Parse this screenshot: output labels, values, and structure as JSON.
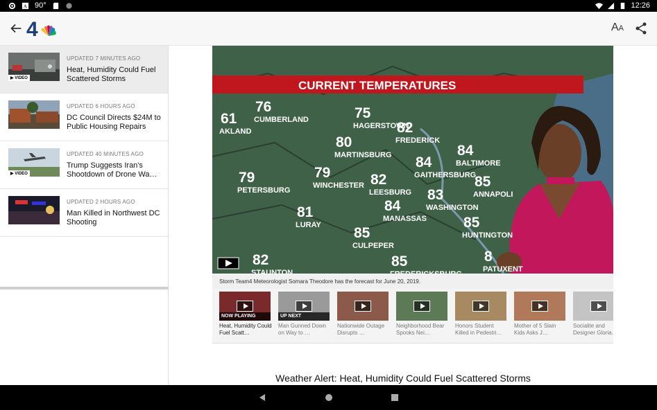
{
  "status_bar": {
    "temperature": "90°",
    "time": "12:26",
    "icons": [
      "settings-icon",
      "nyt-icon",
      "sd-card-icon",
      "circle-icon",
      "wifi-icon",
      "signal-icon",
      "battery-icon"
    ]
  },
  "app_bar": {
    "logo_text": "4",
    "font_size_label": "A",
    "font_size_small": "A",
    "icons": [
      "back-arrow-icon",
      "nbc-peacock-logo",
      "share-icon"
    ]
  },
  "sidebar": {
    "stories": [
      {
        "updated": "UPDATED 7 MINUTES AGO",
        "title": "Heat, Humidity Could Fuel Scattered Storms",
        "video_badge": "▶ VIDEO",
        "active": true
      },
      {
        "updated": "UPDATED 6 HOURS AGO",
        "title": "DC Council Directs $24M to Public Housing Repairs",
        "video_badge": "",
        "active": false
      },
      {
        "updated": "UPDATED 40 MINUTES AGO",
        "title": "Trump Suggests Iran's Shootdown of Drone Wa…",
        "video_badge": "▶ VIDEO",
        "active": false
      },
      {
        "updated": "UPDATED 2 HOURS AGO",
        "title": "Man Killed in Northwest DC Shooting",
        "video_badge": "",
        "active": false
      }
    ]
  },
  "video": {
    "banner": "CURRENT TEMPERATURES",
    "map_temps": [
      {
        "city": "AKLAND",
        "temp": "61"
      },
      {
        "city": "CUMBERLAND",
        "temp": "76"
      },
      {
        "city": "HAGERSTOWN",
        "temp": "75"
      },
      {
        "city": "FREDERICK",
        "temp": "82"
      },
      {
        "city": "MARTINSBURG",
        "temp": "80"
      },
      {
        "city": "BALTIMORE",
        "temp": "84"
      },
      {
        "city": "GAITHERSBURG",
        "temp": "84"
      },
      {
        "city": "PETERSBURG",
        "temp": "79"
      },
      {
        "city": "WINCHESTER",
        "temp": "79"
      },
      {
        "city": "LEESBURG",
        "temp": "82"
      },
      {
        "city": "ANNAPOLI",
        "temp": "85"
      },
      {
        "city": "WASHINGTON",
        "temp": "83"
      },
      {
        "city": "MANASSAS",
        "temp": "84"
      },
      {
        "city": "LURAY",
        "temp": "81"
      },
      {
        "city": "HUNTINGTON",
        "temp": "85"
      },
      {
        "city": "CULPEPER",
        "temp": "85"
      },
      {
        "city": "STAUNTON",
        "temp": "82"
      },
      {
        "city": "FREDERICKSBURG",
        "temp": "85"
      },
      {
        "city": "PATUXENT",
        "temp": "8"
      }
    ],
    "caption": "Storm Team4 Meteorologist Somara Theodore has the forecast for June 20, 2019."
  },
  "playlist": [
    {
      "tag": "NOW PLAYING",
      "title": "Heat, Humidity Could Fuel Scatt…",
      "color": "#7a2a2a"
    },
    {
      "tag": "UP NEXT",
      "title": "Man Gunned Down on Way to …",
      "color": "#9a9a9a"
    },
    {
      "tag": "",
      "title": "Nationwide Outage Disrupts …",
      "color": "#8b5a4a"
    },
    {
      "tag": "",
      "title": "Neighborhood Bear Spooks Nei…",
      "color": "#5d7a56"
    },
    {
      "tag": "",
      "title": "Honors Student Killed in Pedestri…",
      "color": "#a88a62"
    },
    {
      "tag": "",
      "title": "Mother of 5 Slain Kids Asks J…",
      "color": "#b07a5a"
    },
    {
      "tag": "",
      "title": "Socialite and Designer Gloria…",
      "color": "#c4c4c4"
    }
  ],
  "article": {
    "headline": "Weather Alert: Heat, Humidity Could Fuel Scattered Storms"
  },
  "nav_bar": {
    "icons": [
      "back-triangle-icon",
      "home-circle-icon",
      "recents-square-icon"
    ]
  }
}
